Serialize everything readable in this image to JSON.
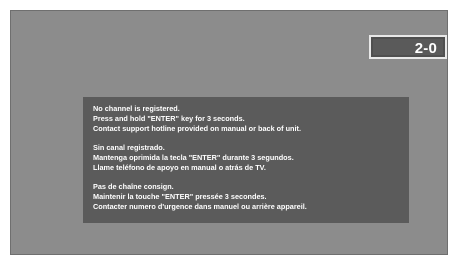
{
  "channel_indicator": {
    "number": "2-0"
  },
  "message": {
    "blocks": [
      {
        "lines": [
          "No channel is registered.",
          "Press and hold \"ENTER\" key for 3 seconds.",
          "Contact support hotline provided on manual or back of unit."
        ]
      },
      {
        "lines": [
          "Sin canal registrado.",
          "Mantenga oprimida la tecla \"ENTER\" durante 3 segundos.",
          "Llame teléfono de apoyo en manual o atrás de TV."
        ]
      },
      {
        "lines": [
          "Pas de chaîne consign.",
          "Maintenir la touche \"ENTER\" pressée 3 secondes.",
          "Contacter numero d'urgence dans manuel ou arrière appareil."
        ]
      }
    ]
  },
  "colors": {
    "screen_background": "#8c8c8c",
    "message_background": "#5b5b5b",
    "text": "#ffffff"
  }
}
